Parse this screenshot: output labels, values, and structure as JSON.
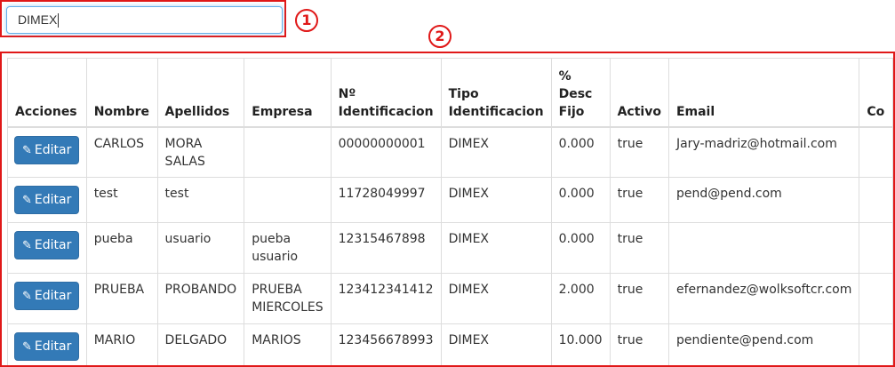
{
  "search": {
    "value": "DIMEX"
  },
  "markers": {
    "first": "1",
    "second": "2"
  },
  "table": {
    "headers": [
      "Acciones",
      "Nombre",
      "Apellidos",
      "Empresa",
      "Nº Identificacion",
      "Tipo Identificacion",
      "% Desc Fijo",
      "Activo",
      "Email",
      "Co"
    ],
    "edit_label": "Editar",
    "rows": [
      {
        "nombre": "CARLOS",
        "apellidos": "MORA SALAS",
        "empresa": "",
        "identificacion": "00000000001",
        "tipo": "DIMEX",
        "desc": "0.000",
        "activo": "true",
        "email": "Jary-madriz@hotmail.com"
      },
      {
        "nombre": "test",
        "apellidos": "test",
        "empresa": "",
        "identificacion": "11728049997",
        "tipo": "DIMEX",
        "desc": "0.000",
        "activo": "true",
        "email": "pend@pend.com"
      },
      {
        "nombre": "pueba",
        "apellidos": "usuario",
        "empresa": "pueba usuario",
        "identificacion": "12315467898",
        "tipo": "DIMEX",
        "desc": "0.000",
        "activo": "true",
        "email": ""
      },
      {
        "nombre": "PRUEBA",
        "apellidos": "PROBANDO",
        "empresa": "PRUEBA MIERCOLES",
        "identificacion": "123412341412",
        "tipo": "DIMEX",
        "desc": "2.000",
        "activo": "true",
        "email": "efernandez@wolksoftcr.com"
      },
      {
        "nombre": "MARIO",
        "apellidos": "DELGADO",
        "empresa": "MARIOS",
        "identificacion": "123456678993",
        "tipo": "DIMEX",
        "desc": "10.000",
        "activo": "true",
        "email": "pendiente@pend.com"
      }
    ]
  }
}
